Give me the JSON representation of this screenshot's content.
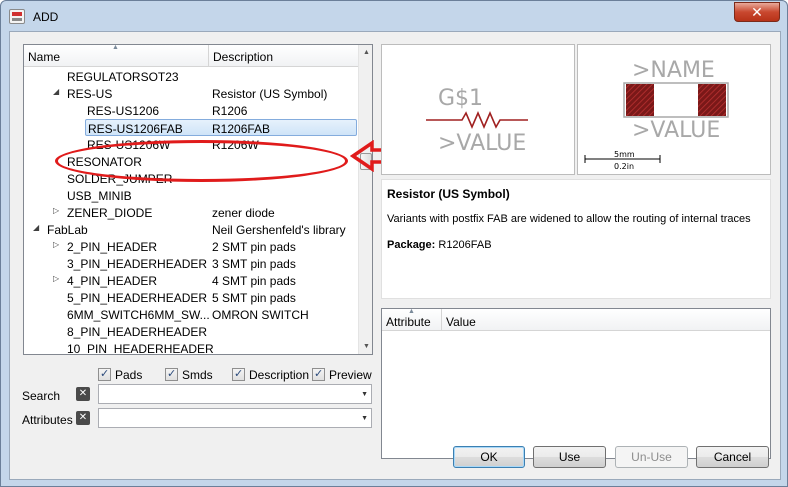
{
  "window": {
    "title": "ADD",
    "close_label": "✕"
  },
  "tree": {
    "columns": {
      "name": "Name",
      "description": "Description"
    },
    "rows": [
      {
        "name": "REGULATORSOT23",
        "desc": "",
        "expander": ""
      },
      {
        "name": "RES-US",
        "desc": "Resistor (US Symbol)",
        "expander": "◢"
      },
      {
        "name": "RES-US1206",
        "desc": "R1206",
        "expander": ""
      },
      {
        "name": "RES-US1206FAB",
        "desc": "R1206FAB",
        "expander": "",
        "selected": true
      },
      {
        "name": "RES-US1206W",
        "desc": "R1206W",
        "expander": ""
      },
      {
        "name": "RESONATOR",
        "desc": "",
        "expander": ""
      },
      {
        "name": "SOLDER_JUMPER",
        "desc": "",
        "expander": ""
      },
      {
        "name": "USB_MINIB",
        "desc": "",
        "expander": ""
      },
      {
        "name": "ZENER_DIODE",
        "desc": "zener diode",
        "expander": "▷"
      },
      {
        "name": "FabLab",
        "desc": "Neil Gershenfeld's library",
        "expander": "◢"
      },
      {
        "name": "2_PIN_HEADER",
        "desc": "2 SMT pin pads",
        "expander": "▷"
      },
      {
        "name": "3_PIN_HEADERHEADER",
        "desc": "3 SMT pin pads",
        "expander": ""
      },
      {
        "name": "4_PIN_HEADER",
        "desc": "4 SMT pin pads",
        "expander": "▷"
      },
      {
        "name": "5_PIN_HEADERHEADER",
        "desc": "5 SMT pin pads",
        "expander": ""
      },
      {
        "name": "6MM_SWITCH6MM_SW...",
        "desc": "OMRON SWITCH",
        "expander": ""
      },
      {
        "name": "8_PIN_HEADERHEADER",
        "desc": "",
        "expander": ""
      },
      {
        "name": "10_PIN_HEADERHEADER",
        "desc": "",
        "expander": ""
      }
    ]
  },
  "symbol_preview": {
    "name_label": "G$1",
    "value_label": ">VALUE"
  },
  "package_preview": {
    "name_label": ">NAME",
    "value_label": ">VALUE",
    "scale_mm": "5mm",
    "scale_in": "0.2in"
  },
  "description": {
    "title": "Resistor (US Symbol)",
    "text": "Variants with postfix FAB are widened to allow the routing of internal traces",
    "package_label": "Package:",
    "package_value": "R1206FAB"
  },
  "attributes": {
    "col_attribute": "Attribute",
    "col_value": "Value"
  },
  "filters": {
    "pads": "Pads",
    "smds": "Smds",
    "description": "Description",
    "preview": "Preview"
  },
  "search": {
    "label": "Search",
    "value": ""
  },
  "attr_filter": {
    "label": "Attributes",
    "value": ""
  },
  "buttons": {
    "ok": "OK",
    "use": "Use",
    "unuse": "Un-Use",
    "cancel": "Cancel"
  },
  "colors": {
    "annotation_red": "#e01b1b",
    "symbol_red": "#a02020",
    "package_red": "#8b1a1a"
  }
}
